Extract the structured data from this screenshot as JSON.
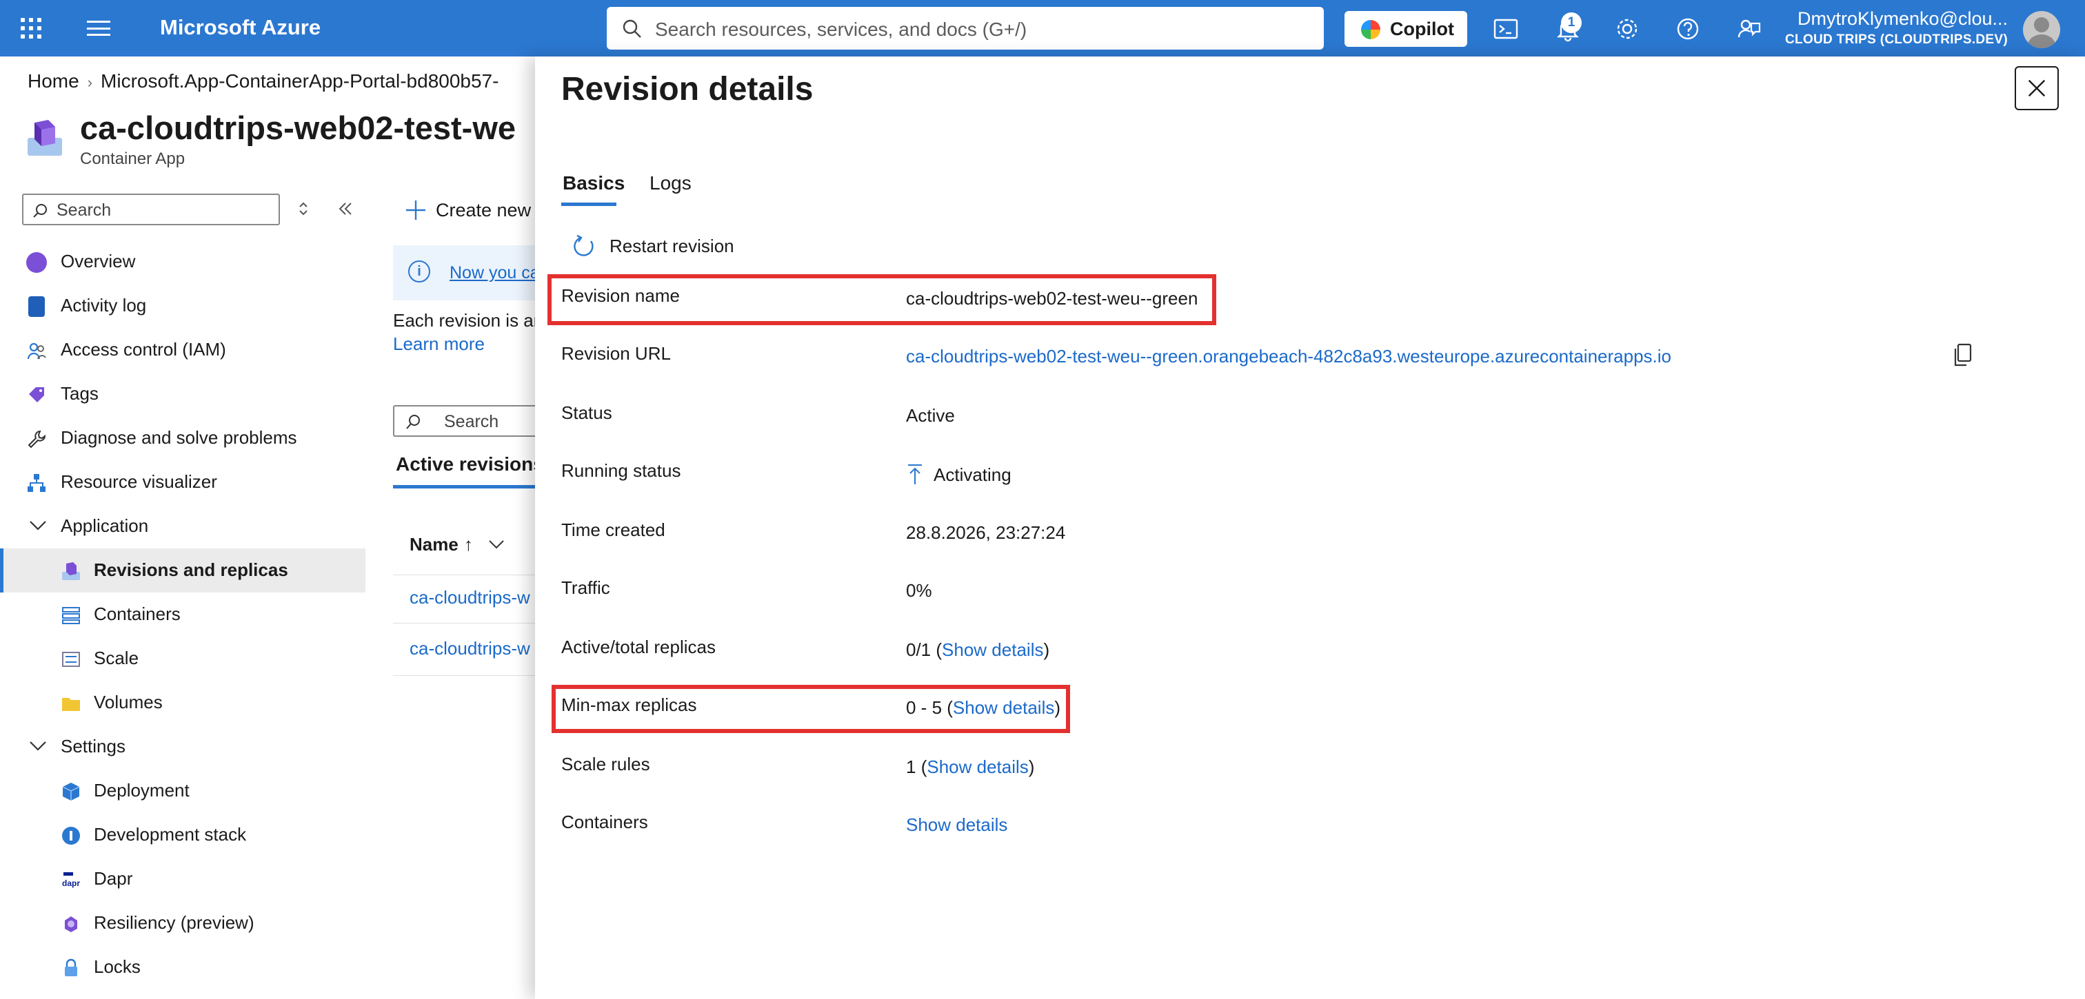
{
  "topbar": {
    "brand": "Microsoft Azure",
    "search_placeholder": "Search resources, services, and docs (G+/)",
    "copilot_label": "Copilot",
    "notification_count": "1",
    "user_name": "DmytroKlymenko@clou...",
    "user_tenant": "CLOUD TRIPS (CLOUDTRIPS.DEV)"
  },
  "breadcrumb": {
    "home": "Home",
    "resource_group": "Microsoft.App-ContainerApp-Portal-bd800b57-"
  },
  "resource": {
    "title": "ca-cloudtrips-web02-test-we",
    "subtitle": "Container App"
  },
  "leftnav": {
    "search_placeholder": "Search",
    "items": [
      {
        "label": "Overview"
      },
      {
        "label": "Activity log"
      },
      {
        "label": "Access control (IAM)"
      },
      {
        "label": "Tags"
      },
      {
        "label": "Diagnose and solve problems"
      },
      {
        "label": "Resource visualizer"
      },
      {
        "label": "Application"
      },
      {
        "label": "Revisions and replicas"
      },
      {
        "label": "Containers"
      },
      {
        "label": "Scale"
      },
      {
        "label": "Volumes"
      },
      {
        "label": "Settings"
      },
      {
        "label": "Deployment"
      },
      {
        "label": "Development stack"
      },
      {
        "label": "Dapr"
      },
      {
        "label": "Resiliency (preview)"
      },
      {
        "label": "Locks"
      }
    ]
  },
  "center": {
    "create_new_label": "Create new r",
    "info_link": "Now you ca",
    "description": "Each revision is an",
    "learn_more": "Learn more",
    "search_placeholder": "Search",
    "tab_active": "Active revisions",
    "col_name": "Name",
    "sort_arrow": "↑",
    "rows": [
      "ca-cloudtrips-w",
      "ca-cloudtrips-w"
    ]
  },
  "blade": {
    "title": "Revision details",
    "tabs": [
      "Basics",
      "Logs"
    ],
    "restart_label": "Restart revision",
    "properties": [
      {
        "label": "Revision name",
        "value": "ca-cloudtrips-web02-test-weu--green"
      },
      {
        "label": "Revision URL",
        "value": "ca-cloudtrips-web02-test-weu--green.orangebeach-482c8a93.westeurope.azurecontainerapps.io"
      },
      {
        "label": "Status",
        "value": "Active"
      },
      {
        "label": "Running status",
        "value": "Activating"
      },
      {
        "label": "Time created",
        "value": "28.8.2026, 23:27:24"
      },
      {
        "label": "Traffic",
        "value": "0%"
      },
      {
        "label": "Active/total replicas",
        "value": "0/1",
        "link": "Show details"
      },
      {
        "label": "Min-max replicas",
        "value": "0 - 5",
        "link": "Show details"
      },
      {
        "label": "Scale rules",
        "value": "1",
        "link": "Show details"
      },
      {
        "label": "Containers",
        "link": "Show details"
      }
    ]
  },
  "colors": {
    "azure_blue": "#2b78d0",
    "link_blue": "#1b6ac9",
    "highlight_red": "#e3312f",
    "selected_nav_bg": "#ebebeb"
  }
}
